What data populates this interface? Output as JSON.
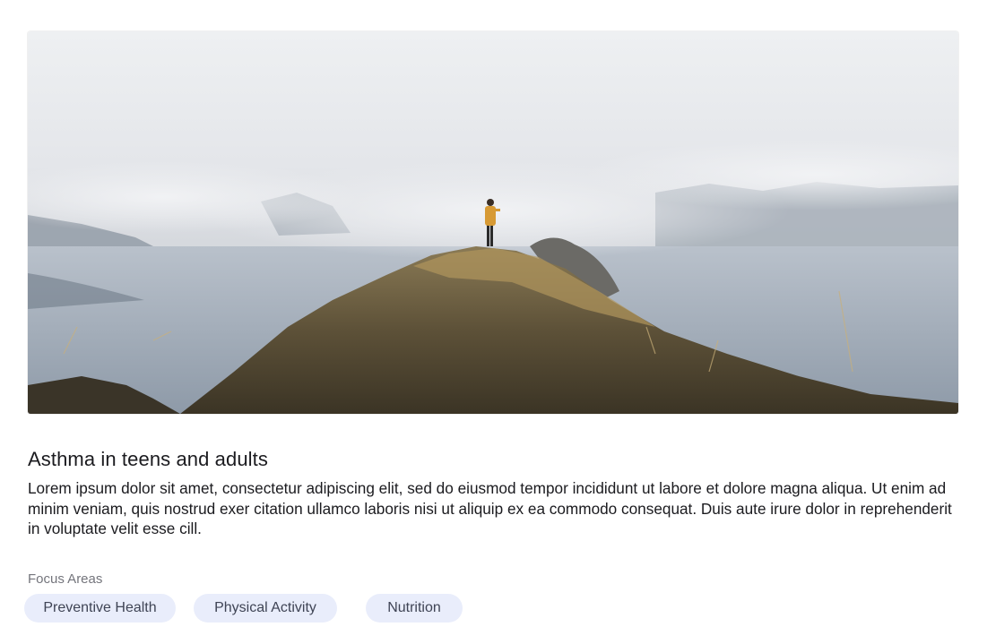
{
  "card": {
    "image_alt": "Hiker standing on a grassy ridge above a misty lake and mountains",
    "title": "Asthma in teens and adults",
    "description": "Lorem ipsum dolor sit amet, consectetur adipiscing elit, sed do eiusmod tempor incididunt ut labore et dolore magna aliqua. Ut enim ad minim veniam, quis nostrud exer citation ullamco laboris nisi ut aliquip ex ea commodo consequat. Duis aute irure dolor in reprehenderit in voluptate velit esse cill.",
    "focus_areas_label": "Focus Areas",
    "focus_areas": [
      "Preventive Health",
      "Physical Activity",
      "Nutrition"
    ]
  },
  "colors": {
    "chip_background": "#e9edfb",
    "chip_text": "#3f4455",
    "label_text": "#74757c",
    "body_text": "#1b1b1f"
  }
}
